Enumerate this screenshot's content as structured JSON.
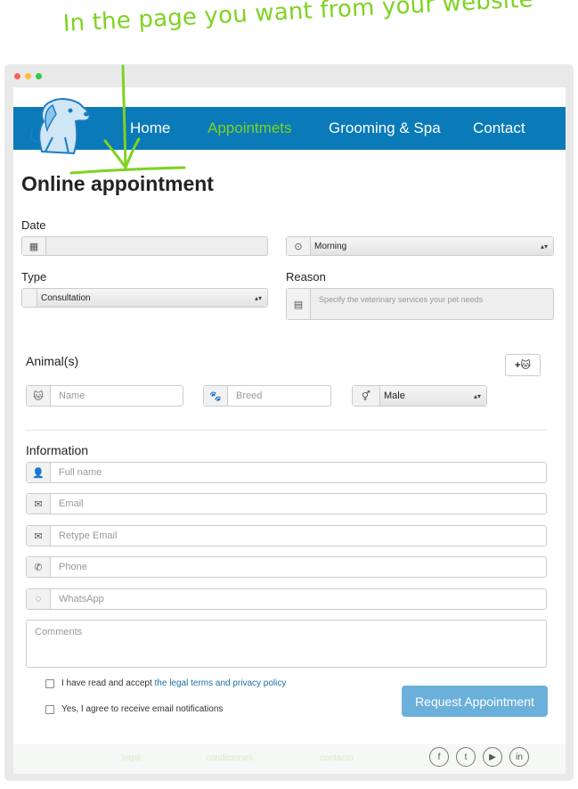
{
  "annotation": "In the page you want from your website",
  "window": {
    "dot_colors": [
      "#fc605c",
      "#fdbc40",
      "#34c84a"
    ]
  },
  "nav": {
    "items": [
      "Home",
      "Appointmets",
      "Grooming & Spa",
      "Contact"
    ],
    "active_index": 1,
    "bar_color": "#0a7ab8",
    "accent": "#7ed321"
  },
  "page_title": "Online appointment",
  "date": {
    "label": "Date",
    "date_value": "",
    "time_value": "Morning"
  },
  "type": {
    "label": "Type",
    "value": "Consultation"
  },
  "reason": {
    "label": "Reason",
    "placeholder": "Specify the veterinary services your pet needs"
  },
  "animals": {
    "label": "Animal(s)",
    "add_label": "+🐱",
    "name_placeholder": "Name",
    "breed_placeholder": "Breed",
    "sex_value": "Male"
  },
  "information": {
    "label": "Information",
    "full_name_placeholder": "Full name",
    "email_placeholder": "Email",
    "retype_email_placeholder": "Retype Email",
    "phone_placeholder": "Phone",
    "whatsapp_placeholder": "WhatsApp",
    "comments_placeholder": "Comments"
  },
  "consent": {
    "terms_prefix": "I have read and accept",
    "terms_link": "the legal terms and privacy policy",
    "notifications": "Yes, I agree to receive email notifications"
  },
  "submit_label": "Request Appointment",
  "footer": {
    "links": [
      "legal",
      "condiciones",
      "contacto"
    ],
    "social_icons": [
      "facebook-icon",
      "twitter-icon",
      "youtube-icon",
      "linkedin-icon"
    ]
  }
}
